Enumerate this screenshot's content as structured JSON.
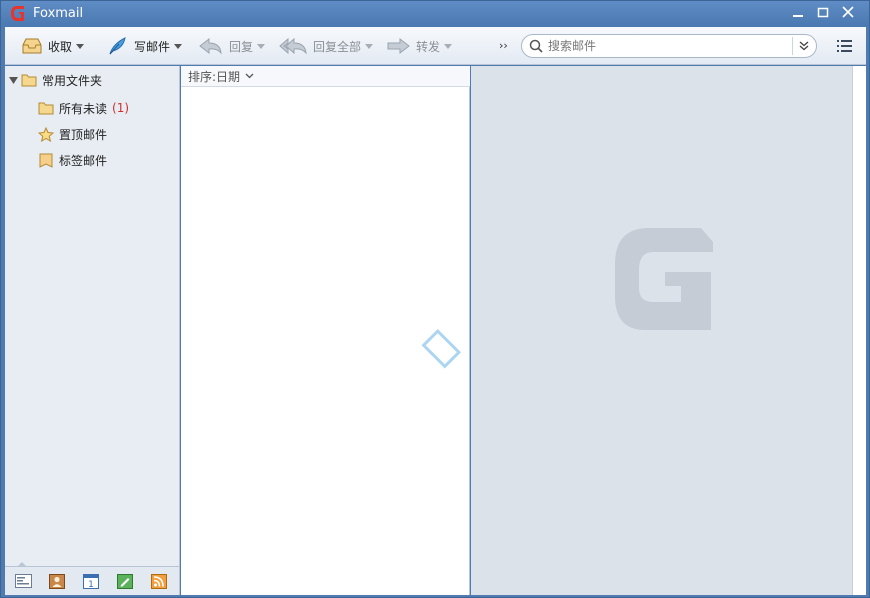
{
  "app": {
    "title": "Foxmail"
  },
  "window_controls": {
    "minimize": "—",
    "maximize": "☐",
    "close": "✕"
  },
  "toolbar": {
    "receive_label": "收取",
    "compose_label": "写邮件",
    "reply_label": "回复",
    "reply_all_label": "回复全部",
    "forward_label": "转发",
    "more_label": "››"
  },
  "search": {
    "placeholder": "搜索邮件",
    "value": ""
  },
  "sidebar": {
    "group_label": "常用文件夹",
    "items": [
      {
        "label": "所有未读",
        "count": "(1)",
        "icon": "folder-icon"
      },
      {
        "label": "置顶邮件",
        "count": "",
        "icon": "star-icon"
      },
      {
        "label": "标签邮件",
        "count": "",
        "icon": "tag-icon"
      }
    ]
  },
  "maillist": {
    "sort_label": "排序:日期"
  },
  "colors": {
    "titlebar": "#4f7bb0",
    "accent_count": "#d03030",
    "preview_bg": "#dbe2ea"
  }
}
